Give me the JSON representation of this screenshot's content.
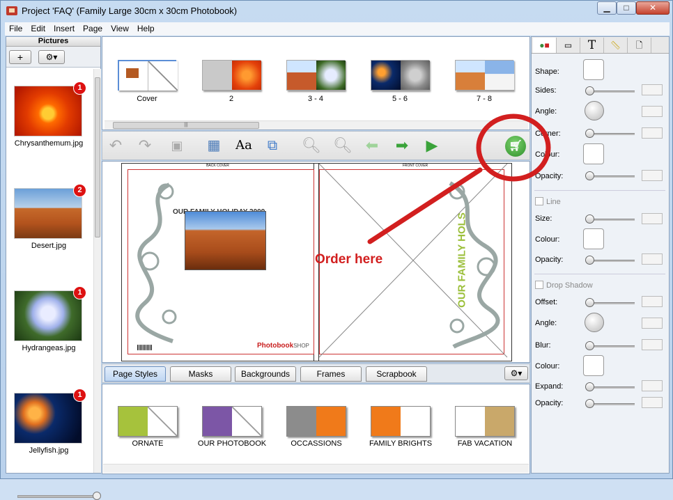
{
  "window": {
    "title": "Project 'FAQ' (Family Large 30cm x 30cm Photobook)",
    "controls": {
      "minimize": "▁",
      "maximize": "□",
      "close": "✕"
    }
  },
  "menu": [
    "File",
    "Edit",
    "Insert",
    "Page",
    "View",
    "Help"
  ],
  "pictures_panel": {
    "title": "Pictures",
    "add_label": "+",
    "gear_label": "⚙▾",
    "items": [
      {
        "name": "Chrysanthemum.jpg",
        "count": "1"
      },
      {
        "name": "Desert.jpg",
        "count": "2"
      },
      {
        "name": "Hydrangeas.jpg",
        "count": "1"
      },
      {
        "name": "Jellyfish.jpg",
        "count": "1"
      }
    ]
  },
  "pages": [
    {
      "label": "Cover"
    },
    {
      "label": "2"
    },
    {
      "label": "3 - 4"
    },
    {
      "label": "5 - 6"
    },
    {
      "label": "7 - 8"
    }
  ],
  "canvas": {
    "back_cover": "BACK COVER",
    "front_cover": "FRONT COVER",
    "back_heading": "OUR FAMILY HOLIDAY 2009",
    "front_title": "OUR FAMILY HOLS",
    "logo_bold": "Photobook",
    "logo_rest": "SHOP"
  },
  "annotation": {
    "text": "Order here",
    "color": "#d21f1f"
  },
  "style_tabs": [
    "Page Styles",
    "Masks",
    "Backgrounds",
    "Frames",
    "Scrapbook"
  ],
  "styles": [
    {
      "label": "ORNATE"
    },
    {
      "label": "OUR PHOTOBOOK"
    },
    {
      "label": "OCCASSIONS"
    },
    {
      "label": "FAMILY BRIGHTS"
    },
    {
      "label": "FAB VACATION"
    }
  ],
  "properties": {
    "shape": "Shape:",
    "sides": "Sides:",
    "angle": "Angle:",
    "corner": "Corner:",
    "colour": "Colour:",
    "opacity": "Opacity:",
    "line": "Line",
    "size": "Size:",
    "line_colour": "Colour:",
    "line_opacity": "Opacity:",
    "drop_shadow": "Drop Shadow",
    "offset": "Offset:",
    "shadow_angle": "Angle:",
    "blur": "Blur:",
    "shadow_colour": "Colour:",
    "expand": "Expand:",
    "shadow_opacity": "Opacity:"
  },
  "colors": {
    "accent": "#d21f1f",
    "cart": "#4caf50",
    "title_green": "#9bbf3a"
  }
}
